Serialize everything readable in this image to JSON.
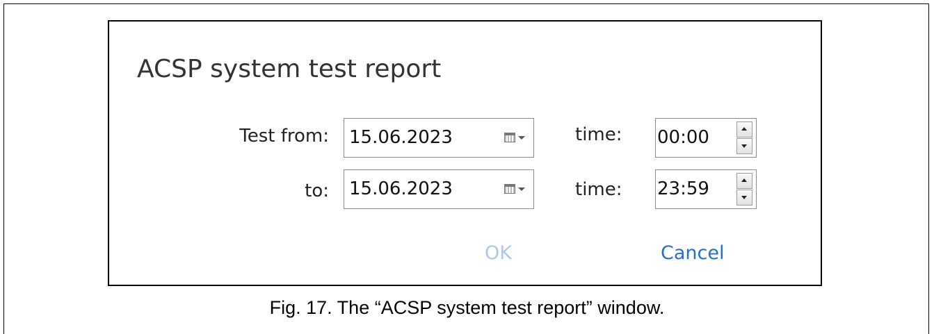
{
  "dialog": {
    "title": "ACSP system test report",
    "from_label": "Test from:",
    "to_label": "to:",
    "time_label": "time:",
    "from_date": "15.06.2023",
    "to_date": "15.06.2023",
    "from_time": "00:00",
    "to_time": "23:59",
    "ok_label": "OK",
    "cancel_label": "Cancel"
  },
  "caption": "Fig. 17. The “ACSP system test report” window.",
  "colors": {
    "ok_disabled": "#a9c8ec",
    "cancel_link": "#2b6fc2"
  },
  "icons": {
    "date_picker": "calendar-dropdown-icon",
    "spin_up": "arrow-up-icon",
    "spin_down": "arrow-down-icon"
  }
}
